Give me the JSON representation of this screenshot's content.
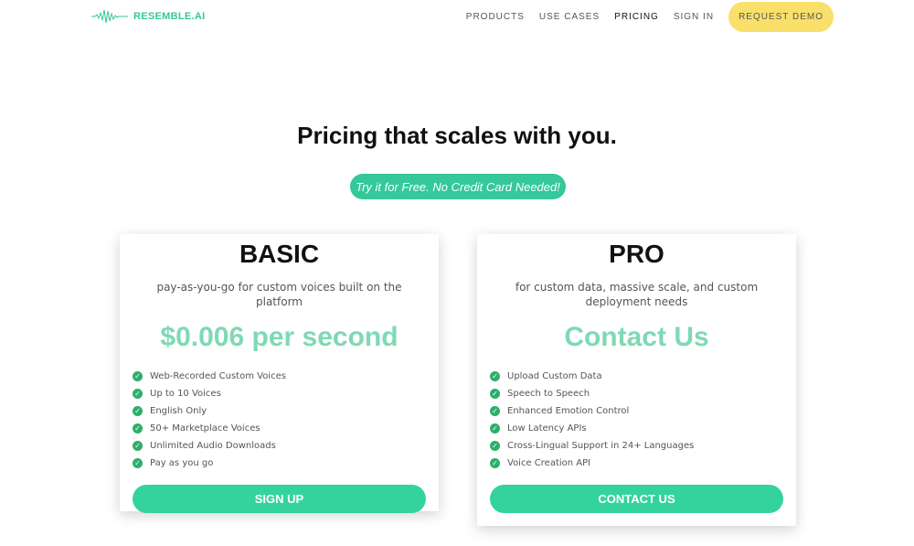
{
  "brand": "RESEMBLE.AI",
  "nav": {
    "items": [
      "PRODUCTS",
      "USE CASES",
      "PRICING",
      "SIGN IN"
    ],
    "active": "PRICING",
    "cta": "REQUEST DEMO"
  },
  "headline": "Pricing that scales with you.",
  "free_button": "Try it for Free. No Credit Card Needed!",
  "plans": [
    {
      "name": "BASIC",
      "subtitle": "pay-as-you-go for custom voices built on the platform",
      "price": "$0.006 per second",
      "features": [
        "Web-Recorded Custom Voices",
        "Up to 10 Voices",
        "English Only",
        "50+ Marketplace Voices",
        "Unlimited Audio Downloads",
        "Pay as you go"
      ],
      "button": "SIGN UP"
    },
    {
      "name": "PRO",
      "subtitle": "for custom data, massive scale, and custom deployment needs",
      "price": "Contact Us",
      "features": [
        "Upload Custom Data",
        "Speech to Speech",
        "Enhanced Emotion Control",
        "Low Latency APIs",
        "Cross-Lingual Support in 24+ Languages",
        "Voice Creation API"
      ],
      "button": "CONTACT US"
    }
  ],
  "colors": {
    "accent": "#34c89a",
    "cta": "#f9e06a",
    "check": "#2eae6c"
  }
}
